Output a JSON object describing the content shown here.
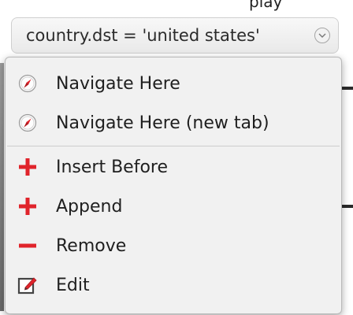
{
  "header": {
    "top_text": "play"
  },
  "token": {
    "label": "country.dst = 'united states'"
  },
  "menu": {
    "items": [
      {
        "label": "Navigate Here",
        "icon": "compass-icon"
      },
      {
        "label": "Navigate Here (new tab)",
        "icon": "compass-icon"
      },
      {
        "label": "Insert Before",
        "icon": "plus-icon"
      },
      {
        "label": "Append",
        "icon": "plus-icon"
      },
      {
        "label": "Remove",
        "icon": "minus-icon"
      },
      {
        "label": "Edit",
        "icon": "edit-icon"
      }
    ]
  },
  "colors": {
    "accent_red": "#e0242b",
    "menu_bg": "#f1f1f1"
  }
}
